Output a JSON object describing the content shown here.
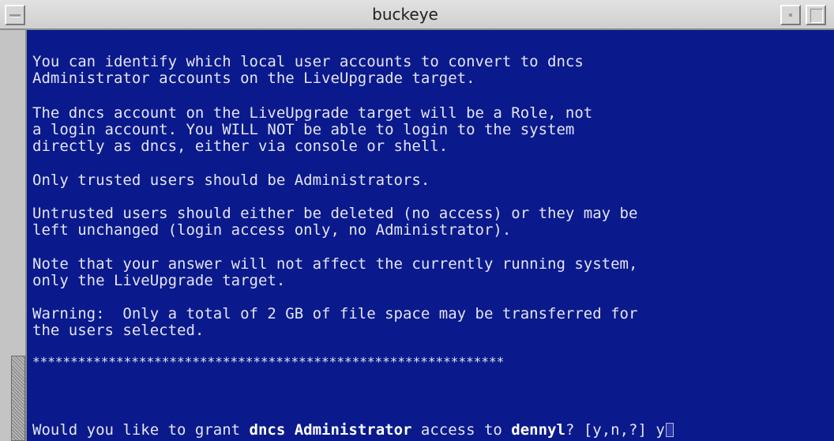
{
  "window": {
    "title": "buckeye"
  },
  "terminal": {
    "lines": [
      "You can identify which local user accounts to convert to dncs",
      "Administrator accounts on the LiveUpgrade target.",
      "The dncs account on the LiveUpgrade target will be a Role, not",
      "a login account. You WILL NOT be able to login to the system",
      "directly as dncs, either via console or shell.",
      "Only trusted users should be Administrators.",
      "Untrusted users should either be deleted (no access) or they may be",
      "left unchanged (login access only, no Administrator).",
      "Note that your answer will not affect the currently running system,",
      "only the LiveUpgrade target.",
      "Warning:  Only a total of 2 GB of file space may be transferred for",
      "the users selected.",
      "**************************************************************"
    ],
    "prompt": {
      "part1": "Would you like to grant ",
      "role": "dncs Administrator",
      "part2": " access to ",
      "user": "dennyl",
      "part3": "? [y,n,?] ",
      "input": "y"
    }
  },
  "icons": {
    "window_menu": "window-menu-icon",
    "minimize": "minimize-icon",
    "maximize": "maximize-icon"
  }
}
